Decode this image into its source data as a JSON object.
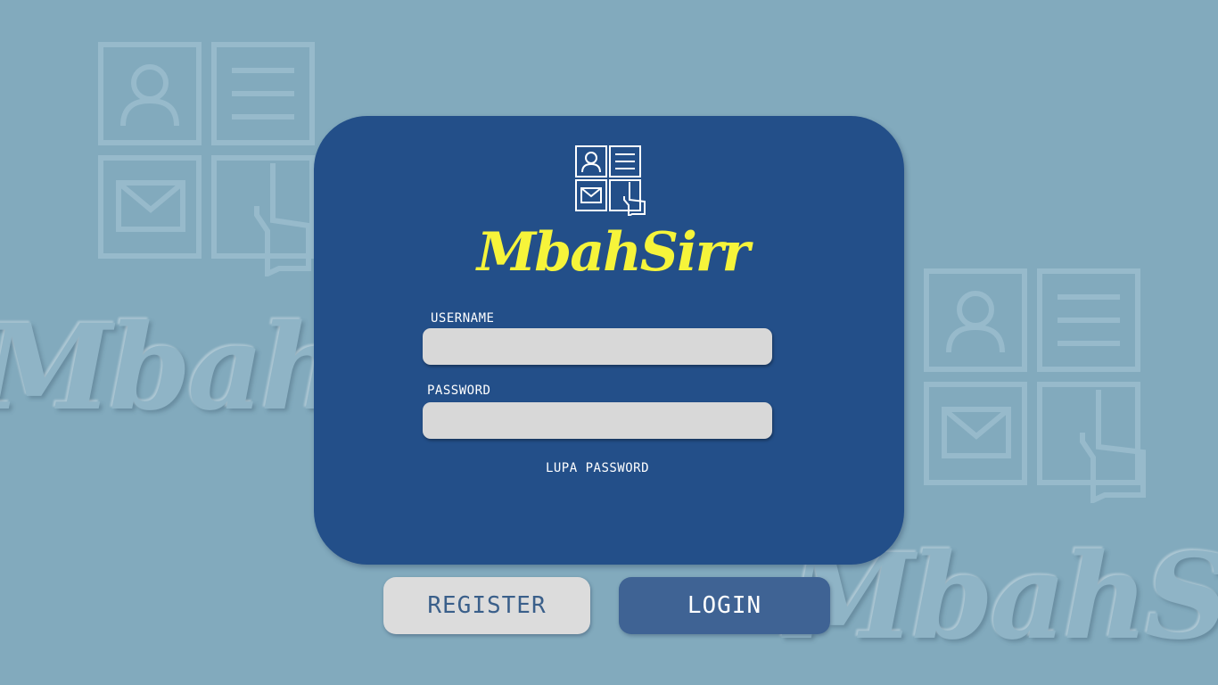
{
  "app": {
    "brand": "MbahSirr",
    "watermark_text": "MbahSirr"
  },
  "form": {
    "username_label": "USERNAME",
    "username_value": "",
    "password_label": "PASSWORD",
    "password_value": "",
    "forgot_label": "LUPA PASSWORD"
  },
  "buttons": {
    "register_label": "REGISTER",
    "login_label": "LOGIN"
  },
  "icons": {
    "logo": "app-logo-icon",
    "user": "user-icon",
    "list": "list-icon",
    "mail": "mail-icon",
    "hand": "hand-pointer-icon"
  },
  "colors": {
    "background": "#82aabd",
    "card": "#234f89",
    "brand": "#f6f43a",
    "input": "#d8d8d8",
    "register_button": "#dcdcdc",
    "login_button": "#3f6394"
  }
}
